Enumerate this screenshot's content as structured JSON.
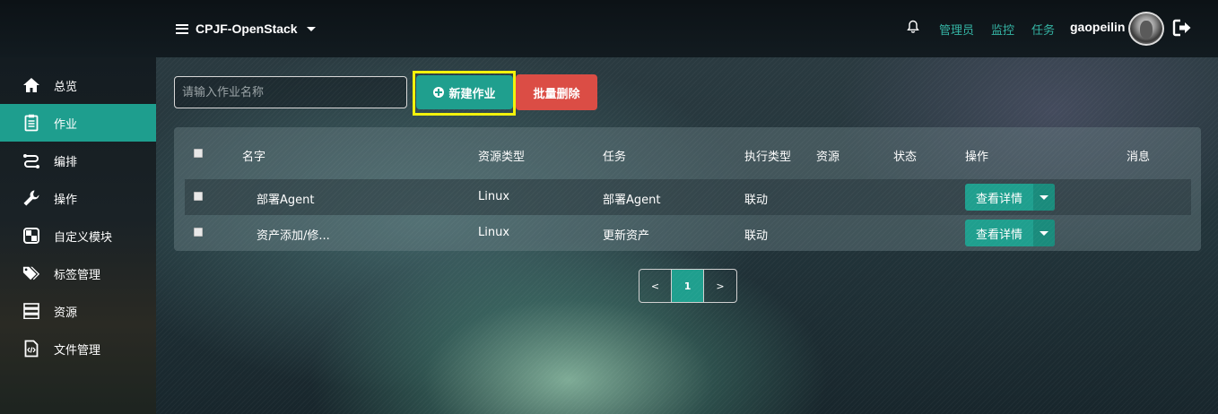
{
  "header": {
    "project": "CPJF-OpenStack",
    "links": [
      "管理员",
      "监控",
      "任务"
    ],
    "username": "gaopeilin"
  },
  "sidebar": {
    "items": [
      {
        "label": "总览",
        "icon": "home-icon"
      },
      {
        "label": "作业",
        "icon": "clipboard-icon",
        "active": true
      },
      {
        "label": "编排",
        "icon": "flow-icon"
      },
      {
        "label": "操作",
        "icon": "wrench-icon"
      },
      {
        "label": "自定义模块",
        "icon": "module-icon"
      },
      {
        "label": "标签管理",
        "icon": "tags-icon"
      },
      {
        "label": "资源",
        "icon": "server-icon"
      },
      {
        "label": "文件管理",
        "icon": "file-code-icon"
      }
    ]
  },
  "toolbar": {
    "search_placeholder": "请输入作业名称",
    "new_label": "新建作业",
    "delete_label": "批量删除"
  },
  "table": {
    "headers": [
      "名字",
      "资源类型",
      "任务",
      "执行类型",
      "资源",
      "状态",
      "操作",
      "消息"
    ],
    "rows": [
      {
        "name": "部署Agent",
        "resource_type": "Linux",
        "task": "部署Agent",
        "exec_type": "联动",
        "resource": "",
        "status": "",
        "action": "查看详情",
        "message": ""
      },
      {
        "name": "资产添加/修...",
        "resource_type": "Linux",
        "task": "更新资产",
        "exec_type": "联动",
        "resource": "",
        "status": "",
        "action": "查看详情",
        "message": ""
      }
    ]
  },
  "pagination": {
    "prev": "<",
    "current": "1",
    "next": ">"
  },
  "colors": {
    "accent": "#1f9f8e",
    "danger": "#db4d45",
    "link": "#35b4a4",
    "highlight": "#f2f20c"
  }
}
